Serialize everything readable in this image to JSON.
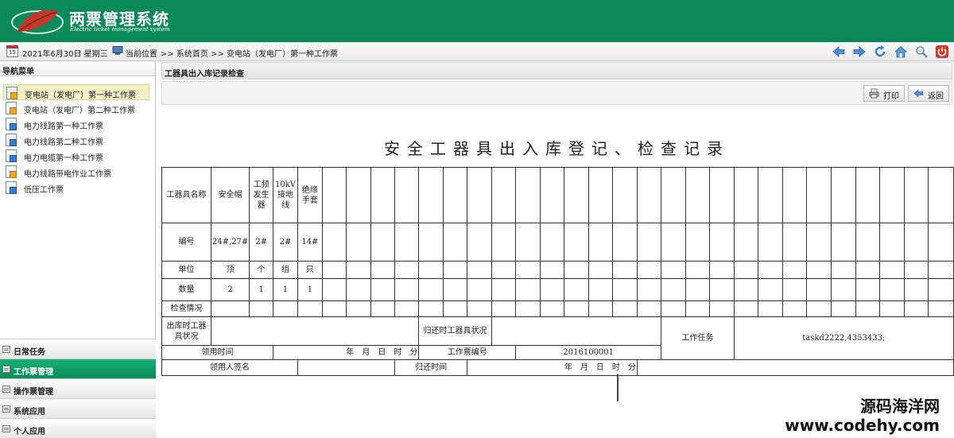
{
  "app": {
    "title_cn": "两票管理系统",
    "title_en": "Electric ticket management system"
  },
  "toolbar": {
    "date": "2021年6月30日 星期三",
    "calendar_day": "15",
    "location_label": "当前位置",
    "breadcrumb": ">> 系统首页 >> 变电站（发电厂）第一种工作票",
    "icons": [
      "back-arrow-icon",
      "forward-arrow-icon",
      "refresh-icon",
      "home-icon",
      "search-icon",
      "power-icon"
    ]
  },
  "sidebar": {
    "title": "导航菜单",
    "items": [
      {
        "label": "变电站（发电厂）第一种工作票",
        "active": true
      },
      {
        "label": "变电站（发电厂）第二种工作票"
      },
      {
        "label": "电力线路第一种工作票"
      },
      {
        "label": "电力线路第二种工作票"
      },
      {
        "label": "电力电缆第一种工作票"
      },
      {
        "label": "电力线路带电作业工作票"
      },
      {
        "label": "低压工作票"
      }
    ],
    "bottom": [
      {
        "label": "日常任务"
      },
      {
        "label": "工作票管理",
        "active": true
      },
      {
        "label": "操作票管理"
      },
      {
        "label": "系统应用"
      },
      {
        "label": "个人应用"
      }
    ]
  },
  "panel": {
    "title": "工器具出入库记录检查",
    "print_label": "打印",
    "back_label": "返回"
  },
  "document": {
    "title": "安全工器具出入库登记、检查记录",
    "row_labels": {
      "name": "工器具名称",
      "number": "编号",
      "unit": "单位",
      "quantity": "数量",
      "check": "检查情况"
    },
    "tools": [
      {
        "name": "安全帽",
        "number": "24#,27#",
        "unit": "顶",
        "quantity": "2"
      },
      {
        "name": "工频发生器",
        "number": "2#",
        "unit": "个",
        "quantity": "1"
      },
      {
        "name": "10kV接地线",
        "number": "2#",
        "unit": "组",
        "quantity": "1"
      },
      {
        "name": "绝缘手套",
        "number": "14#",
        "unit": "只",
        "quantity": "1"
      }
    ],
    "out_status_label": "出库时工器具状况",
    "return_status_label": "归还时工器具状况",
    "work_task_label": "工作任务",
    "work_task_value": "taskd2222,4353433;",
    "borrow_time_label": "领用时间",
    "borrow_time_value": "年　月　日　时　分",
    "ticket_no_label": "工作票编号",
    "ticket_no_value": "2016100001",
    "borrower_sign_label": "领用人签名",
    "return_time_label": "归还时间",
    "return_time_value": "年　月　日　时　分",
    "cut_text": "　　　　　"
  },
  "watermark": {
    "line1": "源码海洋网",
    "line2": "www.codehy.com"
  }
}
